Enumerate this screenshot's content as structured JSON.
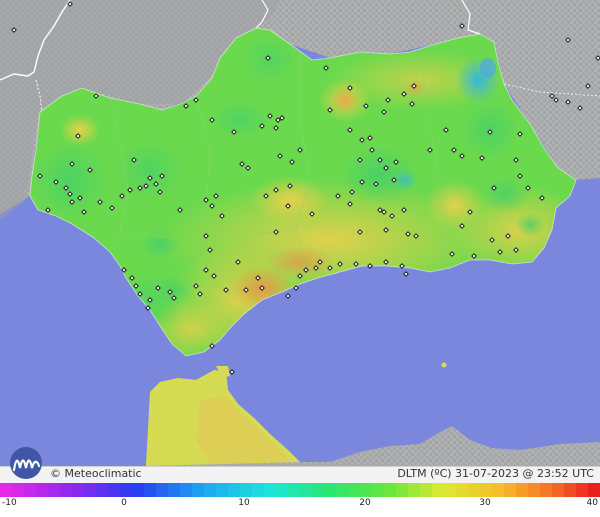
{
  "brand": {
    "name": "Meteoclimatic",
    "logo_icon": "meteoclimatic-logo-icon"
  },
  "caption": "DLTM (ºC)  31-07-2023 @ 23:52 UTC",
  "legend": {
    "ticks": [
      "-10",
      "0",
      "10",
      "20",
      "30",
      "40"
    ],
    "min": -10,
    "max": 40
  },
  "colors": {
    "sea": "#7b87dd",
    "land_outside": "#a9aaab",
    "land_green": "#6edb4d",
    "land_yellow": "#d9e04a",
    "land_orange": "#e8b050",
    "land_cyan": "#3ec0d0"
  }
}
